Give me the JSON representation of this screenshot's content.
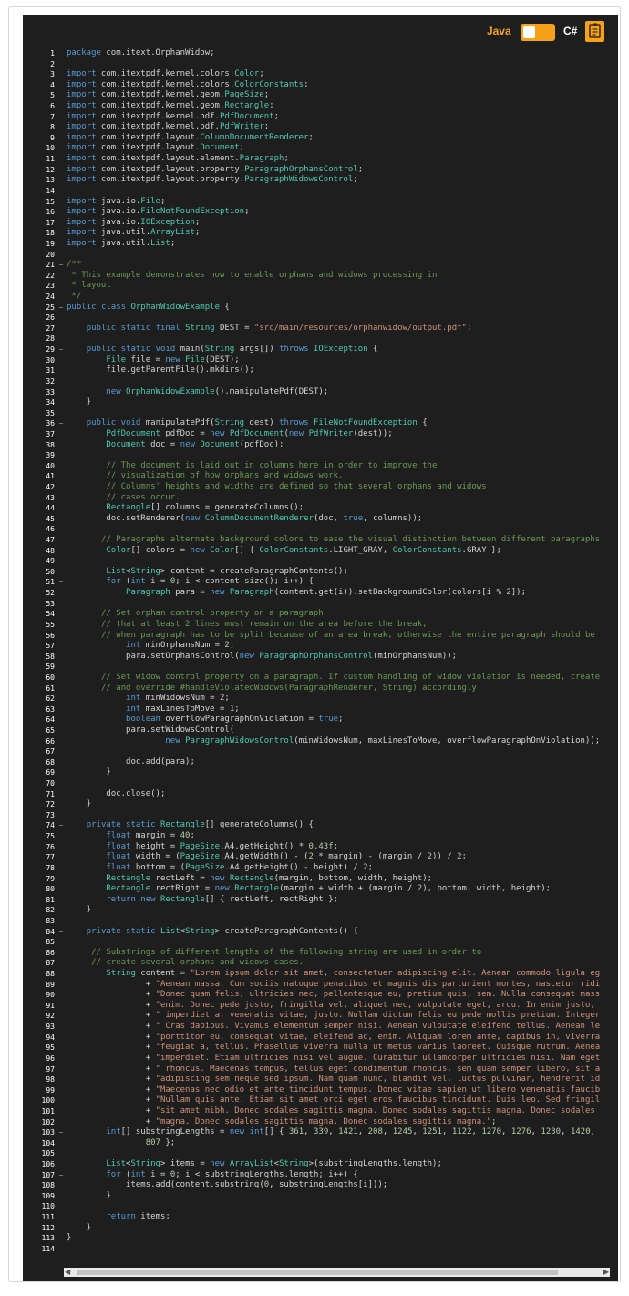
{
  "toolbar": {
    "lang_java": "Java",
    "lang_csharp": "C#",
    "copy_icon": "copy-clipboard-icon",
    "accent": "#f7a11a",
    "java_color": "#f5a024"
  },
  "code": {
    "language": "java",
    "lines": [
      "package com.itext.OrphanWidow;",
      "",
      "import com.itextpdf.kernel.colors.Color;",
      "import com.itextpdf.kernel.colors.ColorConstants;",
      "import com.itextpdf.kernel.geom.PageSize;",
      "import com.itextpdf.kernel.geom.Rectangle;",
      "import com.itextpdf.kernel.pdf.PdfDocument;",
      "import com.itextpdf.kernel.pdf.PdfWriter;",
      "import com.itextpdf.layout.ColumnDocumentRenderer;",
      "import com.itextpdf.layout.Document;",
      "import com.itextpdf.layout.element.Paragraph;",
      "import com.itextpdf.layout.property.ParagraphOrphansControl;",
      "import com.itextpdf.layout.property.ParagraphWidowsControl;",
      "",
      "import java.io.File;",
      "import java.io.FileNotFoundException;",
      "import java.io.IOException;",
      "import java.util.ArrayList;",
      "import java.util.List;",
      "",
      "/**",
      " * This example demonstrates how to enable orphans and widows processing in",
      " * layout",
      " */",
      "public class OrphanWidowExample {",
      "",
      "    public static final String DEST = \"src/main/resources/orphanwidow/output.pdf\";",
      "",
      "    public static void main(String args[]) throws IOException {",
      "        File file = new File(DEST);",
      "        file.getParentFile().mkdirs();",
      "",
      "        new OrphanWidowExample().manipulatePdf(DEST);",
      "    }",
      "",
      "    public void manipulatePdf(String dest) throws FileNotFoundException {",
      "        PdfDocument pdfDoc = new PdfDocument(new PdfWriter(dest));",
      "        Document doc = new Document(pdfDoc);",
      "",
      "        // The document is laid out in columns here in order to improve the",
      "        // visualization of how orphans and widows work.",
      "        // Columns' heights and widths are defined so that several orphans and widows",
      "        // cases occur.",
      "        Rectangle[] columns = generateColumns();",
      "        doc.setRenderer(new ColumnDocumentRenderer(doc, true, columns));",
      "",
      "       // Paragraphs alternate background colors to ease the visual distinction between different paragraphs",
      "        Color[] colors = new Color[] { ColorConstants.LIGHT_GRAY, ColorConstants.GRAY };",
      "",
      "        List<String> content = createParagraphContents();",
      "        for (int i = 0; i < content.size(); i++) {",
      "            Paragraph para = new Paragraph(content.get(i)).setBackgroundColor(colors[i % 2]);",
      "",
      "       // Set orphan control property on a paragraph",
      "       // that at least 2 lines must remain on the area before the break,",
      "       // when paragraph has to be split because of an area break, otherwise the entire paragraph should be",
      "            int minOrphansNum = 2;",
      "            para.setOrphansControl(new ParagraphOrphansControl(minOrphansNum));",
      "",
      "       // Set widow control property on a paragraph. If custom handling of widow violation is needed, create",
      "       // and override #handleViolatedWidows(ParagraphRenderer, String) accordingly.",
      "            int minWidowsNum = 2;",
      "            int maxLinesToMove = 1;",
      "            boolean overflowParagraphOnViolation = true;",
      "            para.setWidowsControl(",
      "                    new ParagraphWidowsControl(minWidowsNum, maxLinesToMove, overflowParagraphOnViolation));",
      "",
      "            doc.add(para);",
      "        }",
      "",
      "        doc.close();",
      "    }",
      "",
      "    private static Rectangle[] generateColumns() {",
      "        float margin = 40;",
      "        float height = PageSize.A4.getHeight() * 0.43f;",
      "        float width = (PageSize.A4.getWidth() - (2 * margin) - (margin / 2)) / 2;",
      "        float bottom = (PageSize.A4.getHeight() - height) / 2;",
      "        Rectangle rectLeft = new Rectangle(margin, bottom, width, height);",
      "        Rectangle rectRight = new Rectangle(margin + width + (margin / 2), bottom, width, height);",
      "        return new Rectangle[] { rectLeft, rectRight };",
      "    }",
      "",
      "    private static List<String> createParagraphContents() {",
      "",
      "     // Substrings of different lengths of the following string are used in order to",
      "     // create several orphans and widows cases.",
      "        String content = \"Lorem ipsum dolor sit amet, consectetuer adipiscing elit. Aenean commodo ligula eg",
      "                + \"Aenean massa. Cum sociis natoque penatibus et magnis dis parturient montes, nascetur ridi",
      "                + \"Donec quam felis, ultricies nec, pellentesque eu, pretium quis, sem. Nulla consequat mass",
      "                + \"enim. Donec pede justo, fringilla vel, aliquet nec, vulputate eget, arcu. In enim justo,",
      "                + \" imperdiet a, venenatis vitae, justo. Nullam dictum felis eu pede mollis pretium. Integer",
      "                + \" Cras dapibus. Vivamus elementum semper nisi. Aenean vulputate eleifend tellus. Aenean le",
      "                + \"porttitor eu, consequat vitae, eleifend ac, enim. Aliquam lorem ante, dapibus in, viverra",
      "                + \"feugiat a, tellus. Phasellus viverra nulla ut metus varius laoreet. Quisque rutrum. Aenea",
      "                + \"imperdiet. Etiam ultricies nisi vel augue. Curabitur ullamcorper ultricies nisi. Nam eget",
      "                + \" rhoncus. Maecenas tempus, tellus eget condimentum rhoncus, sem quam semper libero, sit a",
      "                + \"adipiscing sem neque sed ipsum. Nam quam nunc, blandit vel, luctus pulvinar, hendrerit id",
      "                + \"Maecenas nec odio et ante tincidunt tempus. Donec vitae sapien ut libero venenatis faucib",
      "                + \"Nullam quis ante. Etiam sit amet orci eget eros faucibus tincidunt. Duis leo. Sed fringil",
      "                + \"sit amet nibh. Donec sodales sagittis magna. Donec sodales sagittis magna. Donec sodales",
      "                + \"magna. Donec sodales sagittis magna. Donec sodales sagittis magna.\";",
      "        int[] substringLengths = new int[] { 361, 339, 1421, 208, 1245, 1251, 1122, 1270, 1276, 1230, 1420,",
      "                807 };",
      "",
      "        List<String> items = new ArrayList<String>(substringLengths.length);",
      "        for (int i = 0; i < substringLengths.length; i++) {",
      "            items.add(content.substring(0, substringLengths[i]));",
      "        }",
      "",
      "        return items;",
      "    }",
      "}",
      ""
    ],
    "fold_lines": [
      21,
      25,
      29,
      36,
      51,
      74,
      84,
      103,
      107
    ]
  },
  "scrollbar": {
    "left_arrow_icon": "scroll-left-arrow-icon",
    "right_arrow_icon": "scroll-right-arrow-icon"
  }
}
